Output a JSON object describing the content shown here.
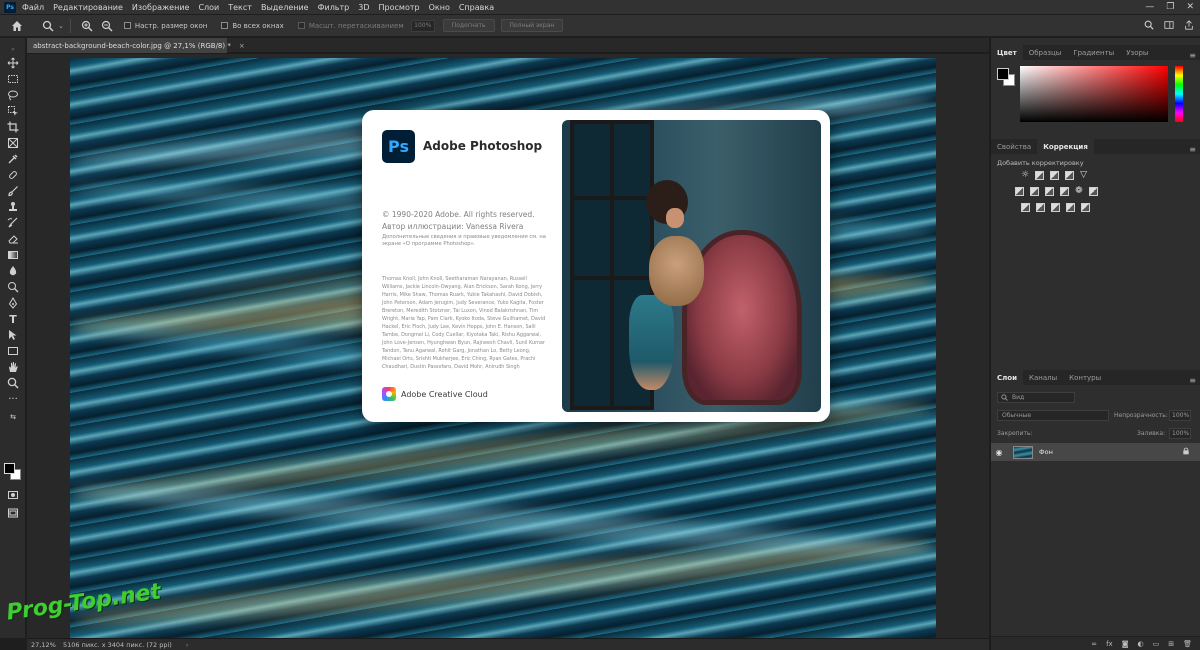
{
  "app": {
    "logo": "Ps"
  },
  "menu": [
    "Файл",
    "Редактирование",
    "Изображение",
    "Слои",
    "Текст",
    "Выделение",
    "Фильтр",
    "3D",
    "Просмотр",
    "Окно",
    "Справка"
  ],
  "options": {
    "fit_screen_label": "Настр. размер окон",
    "all_windows_label": "Во всех окнах",
    "scrubby_zoom_label": "Масшт. перетаскиванием",
    "zoom_value": "100%",
    "fit_button": "Подогнать",
    "fill_screen_button": "Полный экран"
  },
  "document_tab": {
    "title": "abstract-background-beach-color.jpg @ 27,1% (RGB/8) *",
    "close": "×"
  },
  "splash": {
    "product_icon": "Ps",
    "product_name": "Adobe Photoshop",
    "copyright": "© 1990-2020 Adobe. All rights reserved.",
    "author": "Автор иллюстрации: Vanessa Rivera",
    "legal": "Дополнительные сведения и правовые уведомления см. на экране «О программе Photoshop».",
    "credits": "Thomas Knoll, John Knoll, Seetharaman Narayanan, Russell Williams, Jackie Lincoln-Owyang, Alan Erickson, Sarah Kong, Jerry Harris, Mike Shaw, Thomas Ruark, Yukie Takahashi, David Dobish, John Peterson, Adam Jerugim, Judy Severance, Yuko Kagita, Foster Brereton, Meredith Stotzner, Tai Luxon, Vinod Balakrishnan, Tim Wright, Maria Yap, Pam Clark, Kyoko Itoda, Steve Guilhamet, David Hackel, Eric Floch, Judy Lee, Kevin Hopps, John E. Hanson, Salil Tambe, Dongmei Li, Cody Cuellar, Kiyotaka Taki, Rishu Aggarwal, John Love-Jensen, Hyunghwan Byun, Rajneesh Chavli, Sunil Kumar Tandon, Tanu Agarwal, Rohit Garg, Jonathan Lo, Betty Leong, Michael Orts, Srishti Mukherjee, Eric Ching, Ryan Gates, Prachi Chaudhari, Dustin Passofaro, David Mohr, Anirudh Singh",
    "cc_name": "Adobe Creative Cloud"
  },
  "panels": {
    "color_tabs": [
      "Цвет",
      "Образцы",
      "Градиенты",
      "Узоры"
    ],
    "adjust_tabs": [
      "Свойства",
      "Коррекция"
    ],
    "adjust_title": "Добавить корректировку",
    "layers_tabs": [
      "Слои",
      "Каналы",
      "Контуры"
    ],
    "search_placeholder": "Вид",
    "blend_mode": "Обычные",
    "opacity_label": "Непрозрачность:",
    "opacity_value": "100%",
    "lock_label": "Закрепить:",
    "fill_label": "Заливка:",
    "fill_value": "100%",
    "layer_name": "Фон",
    "menu_glyph": "≡"
  },
  "status": {
    "zoom": "27,12%",
    "doc_info": "5106 пикс. x 3404 пикс. (72 ppi)",
    "arrow": "›"
  },
  "watermark": "Prog-Top.net",
  "colors": {
    "accent_blue": "#31a8ff",
    "ps_dark": "#001e36",
    "watermark_green": "#3fce2f"
  }
}
